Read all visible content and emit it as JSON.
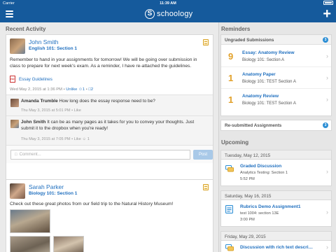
{
  "status_bar": {
    "carrier": "Carrier",
    "time": "11:39 AM"
  },
  "nav": {
    "logo_mark": "S",
    "logo_text": "schoology"
  },
  "recent_activity": {
    "heading": "Recent Activity",
    "post1": {
      "author": "John Smith",
      "course": "English 101: Section 1",
      "body": "Remember to hand in your assignments for tomorrow! We will be going over submission in class to prepare for next week's exam. As a reminder, I have re-attached the guidelines.",
      "attachment": "Essay Guidelines",
      "pdf_label": "PDF",
      "meta_date": "Wed May 2, 2015 at 1:36 PM •",
      "unlike": "Unlike",
      "likes": "1",
      "comments": "2",
      "comment1": {
        "name": "Amanda Trumble",
        "text": "How long does the essay response need to be?",
        "meta": "Thu May 3, 2015 at 5:01 PM • Like"
      },
      "comment2": {
        "name": "John Smith",
        "text": "It can be as many pages as it takes for you to convey your thoughts. Just submit it to the dropbox when you're ready!",
        "meta": "Thu May 3, 2015 at 7:05 PM • Like",
        "likes": "1"
      },
      "comment_placeholder": "Comment...",
      "post_button": "Post"
    },
    "post2": {
      "author": "Sarah Parker",
      "course": "Biology 101: Section 1",
      "body": "Check out these great photos from our field trip to the Natural History Museum!"
    }
  },
  "reminders": {
    "heading": "Reminders",
    "ungraded": {
      "label": "Ungraded Submissions",
      "count": "3",
      "items": [
        {
          "count": "9",
          "title": "Essay: Anatomy Review",
          "course": "Biology 101: Section A"
        },
        {
          "count": "1",
          "title": "Anatomy Paper",
          "course": "Biology 101: TEST Section A"
        },
        {
          "count": "1",
          "title": "Anatomy Review",
          "course": "Biology 101: TEST Section A"
        }
      ]
    },
    "resubmitted": {
      "label": "Re-submitted Assignments",
      "count": "3"
    }
  },
  "upcoming": {
    "heading": "Upcoming",
    "days": [
      {
        "date": "Tuesday, May 12, 2015",
        "title": "Graded Discussion",
        "sub1": "Analytics Testing: Section 1",
        "sub2": "5:52 PM"
      },
      {
        "date": "Saturday, May 16, 2015",
        "title": "Rubrics Demo Assignment1",
        "sub1": "test 1004: section 13E",
        "sub2": "3:00 PM"
      },
      {
        "date": "Friday, May 29, 2015",
        "title": "Discussion with rich text descri…"
      }
    ]
  },
  "colors": {
    "brand": "#155a9c",
    "link": "#1f6fbf",
    "badge": "#2d8fd5",
    "reminder_count": "#e2a12a"
  }
}
